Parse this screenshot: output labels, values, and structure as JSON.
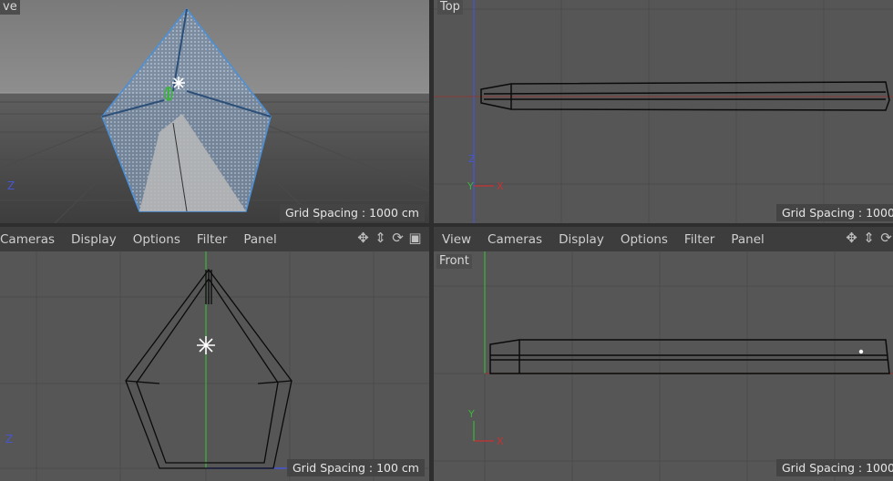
{
  "viewports": {
    "perspective": {
      "label": "ve",
      "grid_spacing": "Grid Spacing : 1000 cm"
    },
    "top": {
      "label": "Top",
      "grid_spacing": "Grid Spacing : 1000"
    },
    "right": {
      "menu": [
        "Cameras",
        "Display",
        "Options",
        "Filter",
        "Panel"
      ],
      "grid_spacing": "Grid Spacing : 100 cm"
    },
    "front": {
      "label": "Front",
      "menu": [
        "View",
        "Cameras",
        "Display",
        "Options",
        "Filter",
        "Panel"
      ],
      "grid_spacing": "Grid Spacing : 1000"
    }
  },
  "axis_labels": {
    "x": "X",
    "y": "Y",
    "z": "Z"
  },
  "nav_icons": [
    "move-view-icon",
    "zoom-view-icon",
    "rotate-view-icon",
    "toggle-panel-icon"
  ],
  "colors": {
    "x_axis": "#c83232",
    "y_axis": "#3cb43c",
    "z_axis": "#4656d2",
    "selection": "#4a90d9"
  }
}
